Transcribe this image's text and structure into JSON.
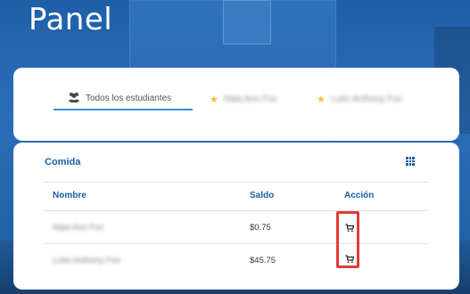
{
  "page": {
    "title": "Panel"
  },
  "tabs": [
    {
      "label": "Todos los estudiantes",
      "icon": "users-icon",
      "active": true
    },
    {
      "label": "Naia Ann Fox",
      "icon": "star-icon",
      "active": false
    },
    {
      "label": "Luke Anthony Fox",
      "icon": "star-icon",
      "active": false
    }
  ],
  "card": {
    "title": "Comida",
    "columns": {
      "name": "Nombre",
      "balance": "Saldo",
      "action": "Acción"
    },
    "rows": [
      {
        "name": "Naia Ann Fox",
        "balance": "$0.75",
        "action_icon": "cart-icon"
      },
      {
        "name": "Luke Anthony Fox",
        "balance": "$45.75",
        "action_icon": "cart-icon"
      }
    ]
  },
  "colors": {
    "accent": "#1b5fa8",
    "highlight": "#e23b3b",
    "star": "#f2c230"
  }
}
